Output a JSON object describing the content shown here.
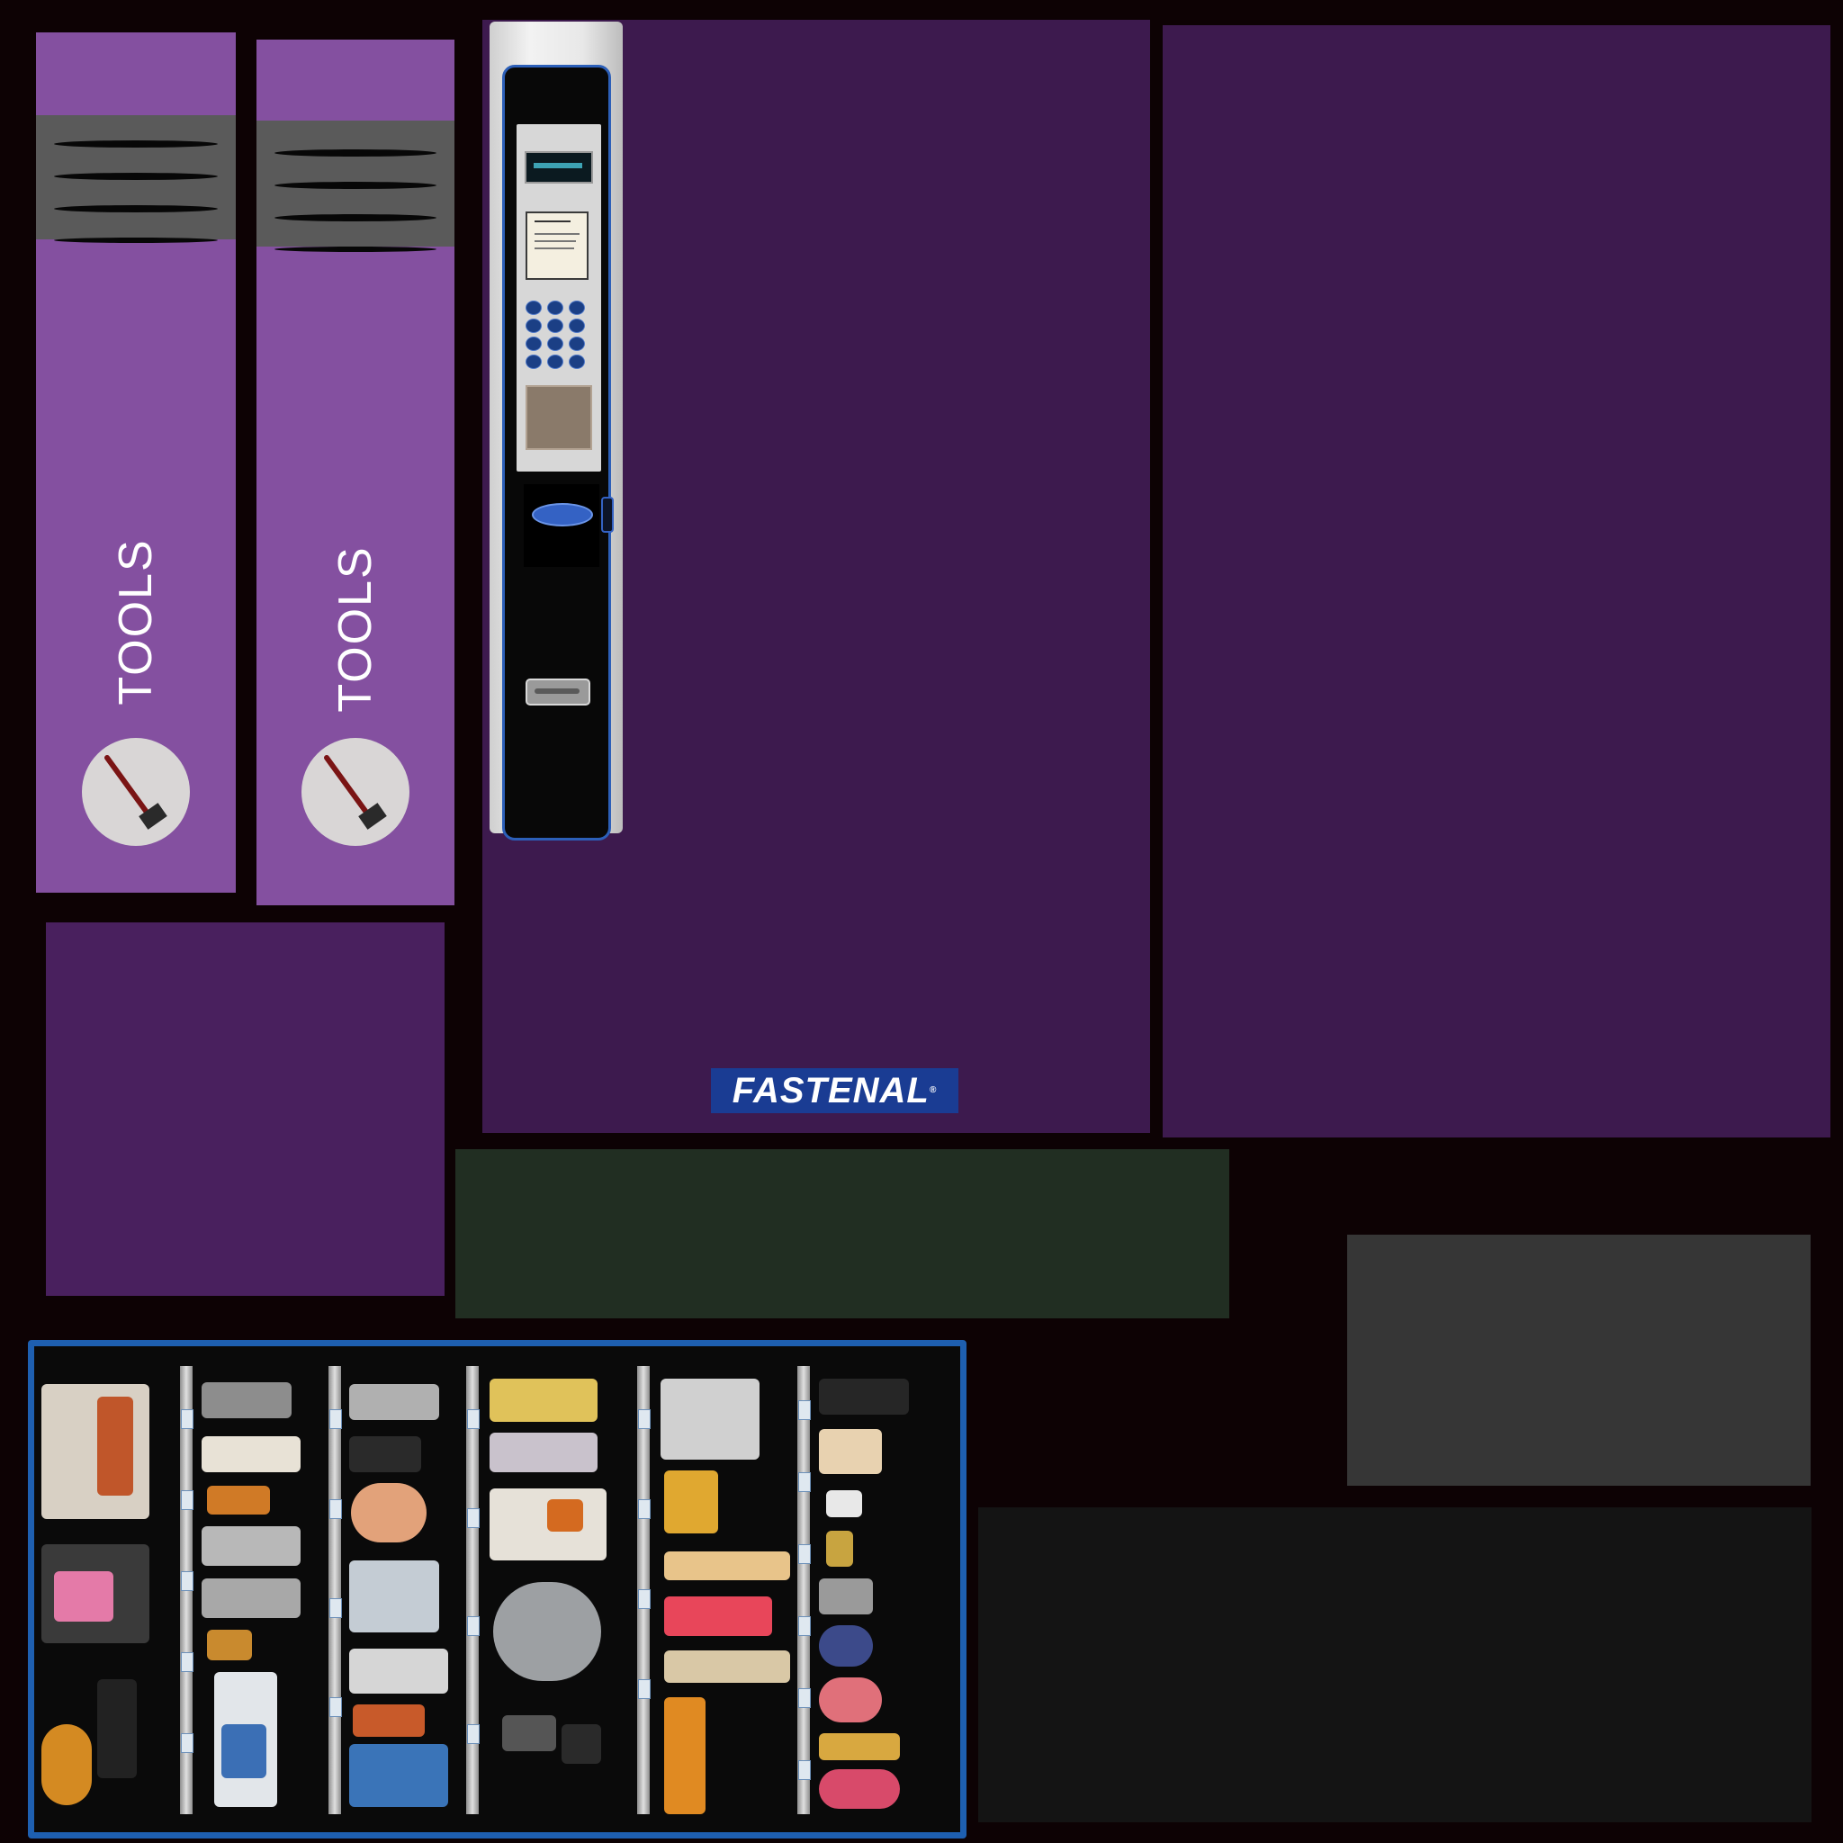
{
  "panels": {
    "tools_left": {
      "label": "TOOLS"
    },
    "tools_right": {
      "label": "TOOLS"
    }
  },
  "logo": {
    "text": "FASTENAL",
    "mark": "®"
  },
  "colors": {
    "background": "#0d0204",
    "tools_panel": "#8450a0",
    "purple_panel": "#3d1a4e",
    "logo_blue": "#1a3c93",
    "drawer_frame": "#1e5fb0"
  },
  "icons": {
    "tools_badge": "hammer-icon"
  }
}
